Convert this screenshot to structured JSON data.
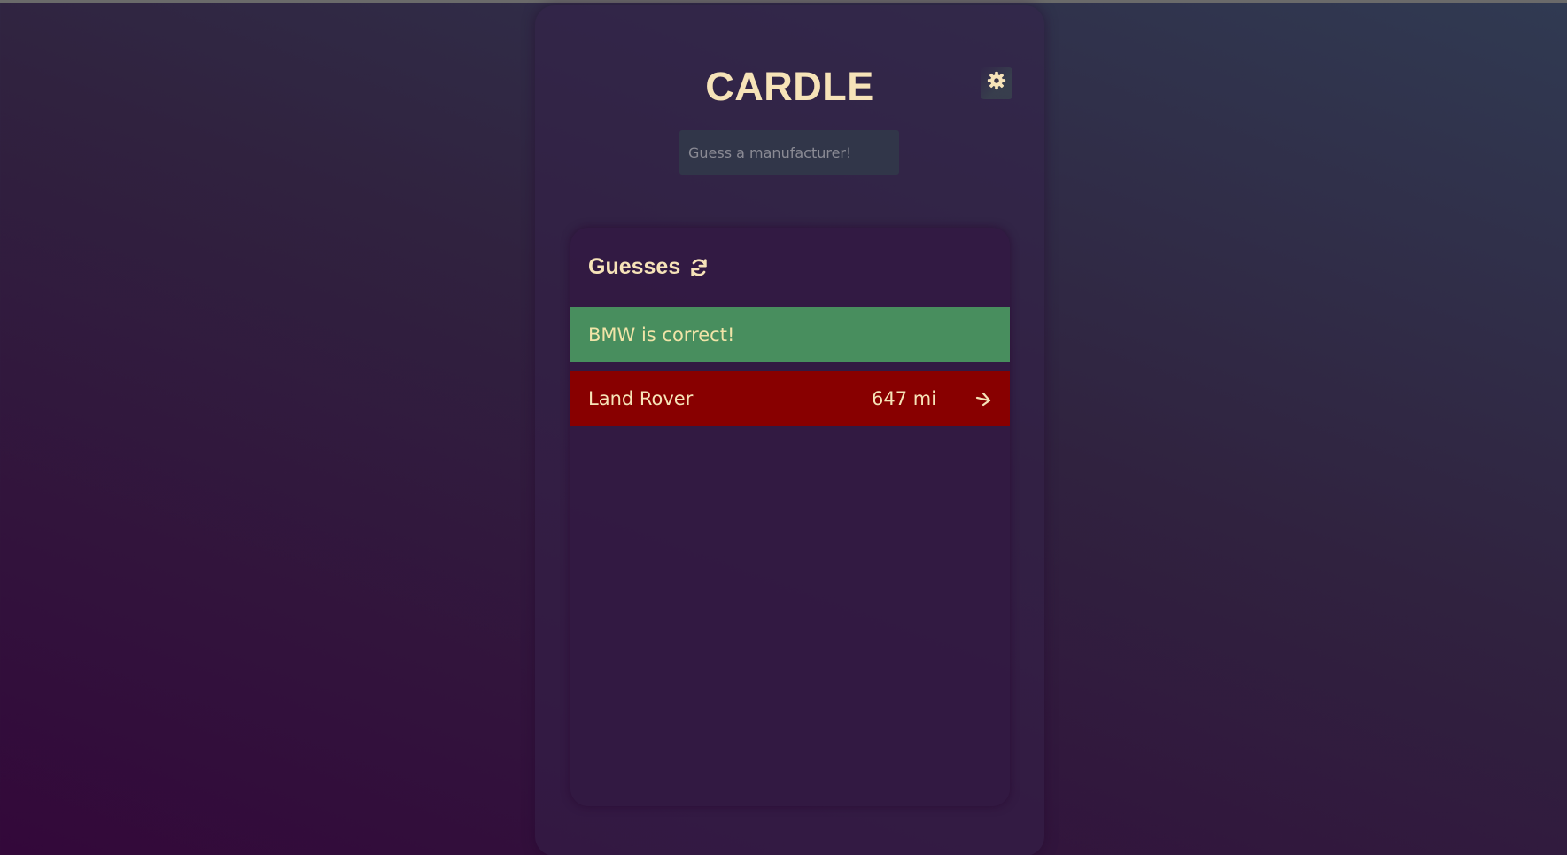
{
  "app": {
    "title": "CARDLE",
    "settings_icon": "gear-icon"
  },
  "search": {
    "placeholder": "Guess a manufacturer!",
    "value": ""
  },
  "guesses": {
    "title": "Guesses",
    "refresh_icon": "refresh-icon",
    "items": [
      {
        "text": "BMW is correct!",
        "status": "correct",
        "color": "#488e5e"
      },
      {
        "name": "Land Rover",
        "distance": "647 mi",
        "direction_icon": "arrow-right-icon",
        "status": "wrong",
        "color": "#880000"
      }
    ]
  },
  "colors": {
    "text_accent": "#f6e3b8",
    "correct": "#488e5e",
    "wrong": "#880000",
    "input_bg": "#313649"
  }
}
